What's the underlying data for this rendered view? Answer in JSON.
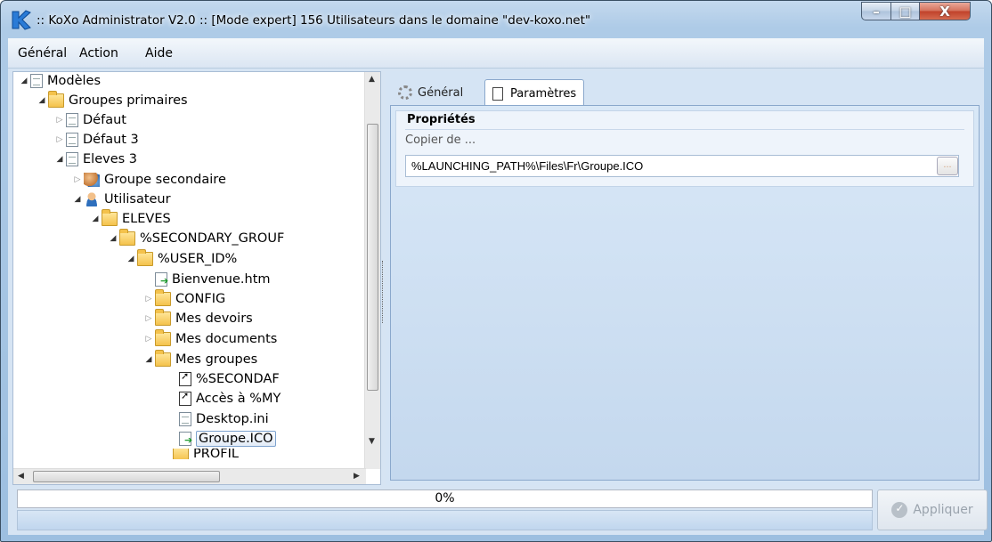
{
  "window": {
    "title": ":: KoXo Administrator V2.0 :: [Mode expert] 156 Utilisateurs dans le domaine \"dev-koxo.net\"",
    "controls": {
      "minimize": "–",
      "maximize": "□",
      "close": "X"
    }
  },
  "menu": [
    {
      "label": "Général",
      "underline": "G",
      "rest": "énéral"
    },
    {
      "label": "Action",
      "pre": "A",
      "underline": "c",
      "rest": "tion"
    },
    {
      "label": "Aide",
      "underline": "A",
      "rest": "ide"
    }
  ],
  "tree": {
    "nodes": [
      {
        "label": "Modèles",
        "icon": "template-icon",
        "expanded": true
      },
      {
        "label": "Groupes primaires",
        "icon": "folder-icon",
        "expanded": true
      },
      {
        "label": "Défaut",
        "icon": "document-icon",
        "expanded": false
      },
      {
        "label": "Défaut 3",
        "icon": "document-icon",
        "expanded": false
      },
      {
        "label": "Eleves 3",
        "icon": "document-icon",
        "expanded": true
      },
      {
        "label": "Groupe secondaire",
        "icon": "group-icon",
        "expanded": false
      },
      {
        "label": "Utilisateur",
        "icon": "user-icon",
        "expanded": true
      },
      {
        "label": "ELEVES",
        "icon": "folder-icon",
        "expanded": true
      },
      {
        "label": "%SECONDARY_GROUF",
        "icon": "folder-icon",
        "expanded": true
      },
      {
        "label": "%USER_ID%",
        "icon": "folder-icon",
        "expanded": true
      },
      {
        "label": "Bienvenue.htm",
        "icon": "file-copy-icon"
      },
      {
        "label": "CONFIG",
        "icon": "folder-icon",
        "expanded": false
      },
      {
        "label": "Mes devoirs",
        "icon": "folder-icon",
        "expanded": false
      },
      {
        "label": "Mes documents",
        "icon": "folder-icon",
        "expanded": false
      },
      {
        "label": "Mes groupes",
        "icon": "folder-icon",
        "expanded": true
      },
      {
        "label": "%SECONDAF",
        "icon": "shortcut-icon"
      },
      {
        "label": "Accès à %MY",
        "icon": "shortcut-icon"
      },
      {
        "label": "Desktop.ini",
        "icon": "ini-file-icon"
      },
      {
        "label": "Groupe.ICO",
        "icon": "file-copy-icon",
        "selected": true
      },
      {
        "label": "PROFIL",
        "icon": "folder-icon"
      }
    ]
  },
  "tabs": [
    {
      "label": "Général",
      "icon": "gear-icon",
      "active": false
    },
    {
      "label": "Paramètres",
      "icon": "page-icon",
      "active": true
    }
  ],
  "properties": {
    "title": "Propriétés",
    "copy_label": "Copier de ...",
    "path_value": "%LAUNCHING_PATH%\\Files\\Fr\\Groupe.ICO",
    "browse_label": "..."
  },
  "progress": {
    "text": "0%",
    "value": 0
  },
  "apply_button": {
    "label": "Appliquer",
    "enabled": false
  }
}
